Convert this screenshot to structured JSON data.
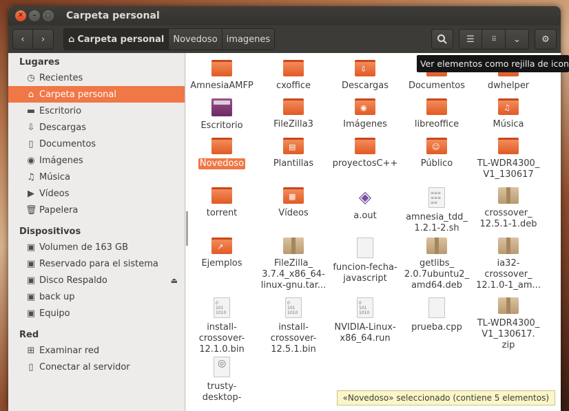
{
  "window": {
    "title": "Carpeta personal"
  },
  "toolbar": {
    "crumbs": [
      "Carpeta personal",
      "Novedoso",
      "imagenes"
    ]
  },
  "tooltip": "Ver elementos como rejilla de iconos",
  "sidebar": {
    "sections": [
      {
        "title": "Lugares",
        "items": [
          {
            "label": "Recientes",
            "icon": "clock-icon"
          },
          {
            "label": "Carpeta personal",
            "icon": "home-icon",
            "selected": true
          },
          {
            "label": "Escritorio",
            "icon": "desktop-folder-icon"
          },
          {
            "label": "Descargas",
            "icon": "download-icon"
          },
          {
            "label": "Documentos",
            "icon": "document-icon"
          },
          {
            "label": "Imágenes",
            "icon": "camera-icon"
          },
          {
            "label": "Música",
            "icon": "music-icon"
          },
          {
            "label": "Vídeos",
            "icon": "video-icon"
          },
          {
            "label": "Papelera",
            "icon": "trash-icon"
          }
        ]
      },
      {
        "title": "Dispositivos",
        "items": [
          {
            "label": "Volumen de 163 GB",
            "icon": "drive-icon"
          },
          {
            "label": "Reservado para el sistema",
            "icon": "drive-icon"
          },
          {
            "label": "Disco Respaldo",
            "icon": "drive-icon",
            "eject": true
          },
          {
            "label": "back up",
            "icon": "drive-icon"
          },
          {
            "label": "Equipo",
            "icon": "drive-icon"
          }
        ]
      },
      {
        "title": "Red",
        "items": [
          {
            "label": "Examinar red",
            "icon": "network-icon"
          },
          {
            "label": "Conectar al servidor",
            "icon": "server-icon"
          }
        ]
      }
    ]
  },
  "files": [
    {
      "name": "AmnesiaAMFP",
      "kind": "folder"
    },
    {
      "name": "cxoffice",
      "kind": "folder"
    },
    {
      "name": "Descargas",
      "kind": "folder",
      "emblem": "download"
    },
    {
      "name": "Documentos",
      "kind": "folder"
    },
    {
      "name": "dwhelper",
      "kind": "folder"
    },
    {
      "name": "Escritorio",
      "kind": "desktop"
    },
    {
      "name": "FileZilla3",
      "kind": "folder"
    },
    {
      "name": "Imágenes",
      "kind": "folder",
      "emblem": "camera"
    },
    {
      "name": "libreoffice",
      "kind": "folder"
    },
    {
      "name": "Música",
      "kind": "folder",
      "emblem": "music"
    },
    {
      "name": "Novedoso",
      "kind": "folder",
      "selected": true
    },
    {
      "name": "Plantillas",
      "kind": "folder",
      "emblem": "template"
    },
    {
      "name": "proyectosC++",
      "kind": "folder"
    },
    {
      "name": "Público",
      "kind": "folder",
      "emblem": "person"
    },
    {
      "name": "TL-WDR4300_ V1_130617",
      "kind": "folder"
    },
    {
      "name": "torrent",
      "kind": "folder"
    },
    {
      "name": "Vídeos",
      "kind": "folder",
      "emblem": "film"
    },
    {
      "name": "a.out",
      "kind": "binary"
    },
    {
      "name": "amnesia_tdd_ 1.2.1-2.sh",
      "kind": "script"
    },
    {
      "name": "crossover_ 12.5.1-1.deb",
      "kind": "package"
    },
    {
      "name": "Ejemplos",
      "kind": "folder",
      "emblem": "link"
    },
    {
      "name": "FileZilla_ 3.7.4_x86_64- linux-gnu.tar...",
      "kind": "package"
    },
    {
      "name": "funcion-fecha- javascript",
      "kind": "text"
    },
    {
      "name": "getlibs_ 2.0.7ubuntu2_ amd64.deb",
      "kind": "package"
    },
    {
      "name": "ia32- crossover_ 12.1.0-1_am...",
      "kind": "package"
    },
    {
      "name": "install- crossover- 12.1.0.bin",
      "kind": "binary-doc"
    },
    {
      "name": "install- crossover- 12.5.1.bin",
      "kind": "binary-doc"
    },
    {
      "name": "NVIDIA-Linux- x86_64.run",
      "kind": "binary-doc"
    },
    {
      "name": "prueba.cpp",
      "kind": "text"
    },
    {
      "name": "TL-WDR4300_ V1_130617. zip",
      "kind": "package"
    },
    {
      "name": "trusty- desktop-",
      "kind": "disc"
    }
  ],
  "status": "«Novedoso» seleccionado (contiene 5 elementos)",
  "colors": {
    "accent": "#f07746",
    "titlebar": "#3c3b37"
  }
}
